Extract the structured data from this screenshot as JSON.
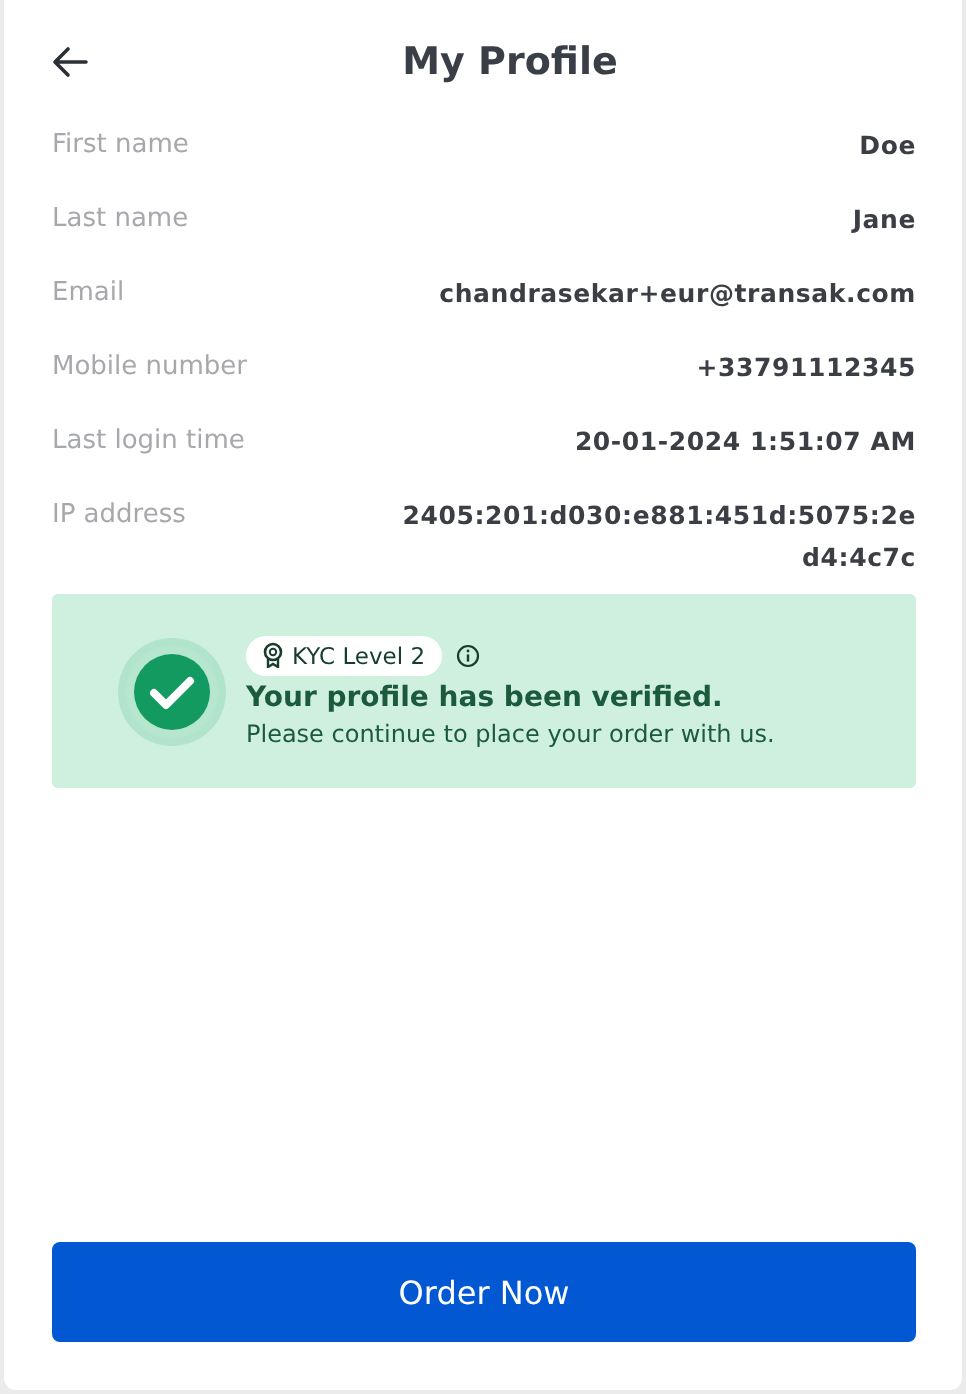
{
  "header": {
    "title": "My Profile"
  },
  "fields": [
    {
      "label": "First name",
      "value": "Doe"
    },
    {
      "label": "Last name",
      "value": "Jane"
    },
    {
      "label": "Email",
      "value": "chandrasekar+eur@transak.com"
    },
    {
      "label": "Mobile number",
      "value": "+33791112345"
    },
    {
      "label": "Last login time",
      "value": "20-01-2024 1:51:07 AM"
    },
    {
      "label": "IP address",
      "value": "2405:201:d030:e881:451d:5075:2ed4:4c7c"
    }
  ],
  "verification": {
    "badge": "KYC Level 2",
    "title": "Your profile has been verified.",
    "message": "Please continue to place your order with us."
  },
  "order_button": "Order Now"
}
